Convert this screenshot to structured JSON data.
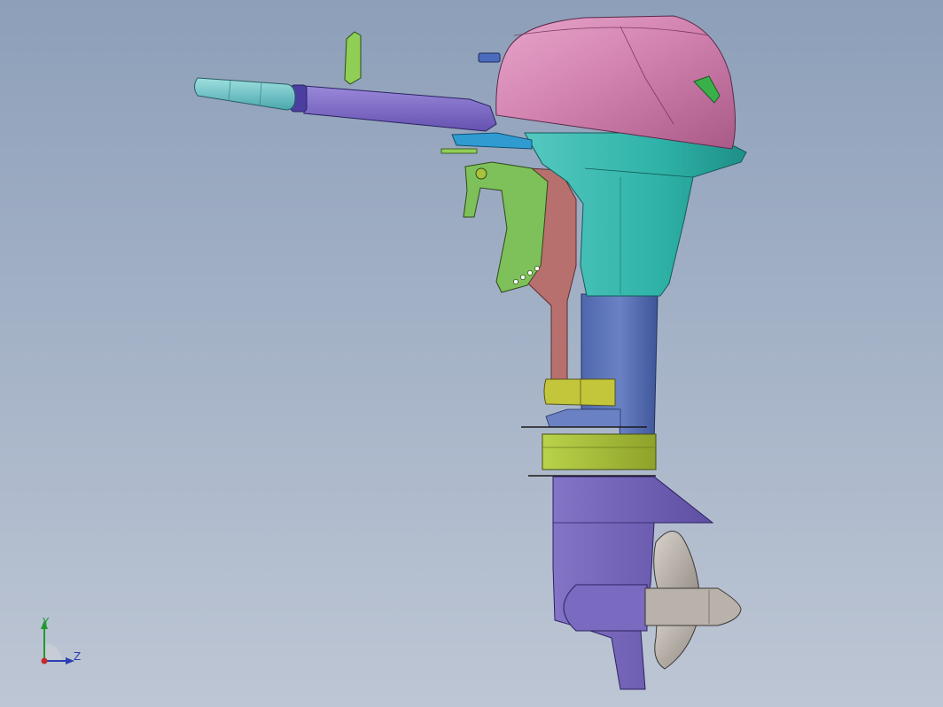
{
  "view": {
    "background_top": "#8d9fb9",
    "background_bottom": "#bdc6d4"
  },
  "model": {
    "parts": [
      {
        "name": "engine-cowl-top",
        "color": "#d383b0"
      },
      {
        "name": "lower-cowling",
        "color": "#2fb3a8"
      },
      {
        "name": "tiller-handle",
        "color": "#7c67c4"
      },
      {
        "name": "throttle-grip",
        "color": "#6cc6c9"
      },
      {
        "name": "clamp-bracket",
        "color": "#7ec05a"
      },
      {
        "name": "swivel-bracket",
        "color": "#b7706d"
      },
      {
        "name": "driveshaft-housing",
        "color": "#5d75b8"
      },
      {
        "name": "mount-block",
        "color": "#c3c63a"
      },
      {
        "name": "anti-ventilation-plate",
        "color": "#a8c23c"
      },
      {
        "name": "gearcase",
        "color": "#7162b3"
      },
      {
        "name": "propeller",
        "color": "#b9b2ab"
      }
    ]
  },
  "triad": {
    "y_label": "Y",
    "z_label": "Z",
    "y_color": "#1f9a2e",
    "z_color": "#2b3fb0",
    "x_color": "#c42a2a"
  }
}
